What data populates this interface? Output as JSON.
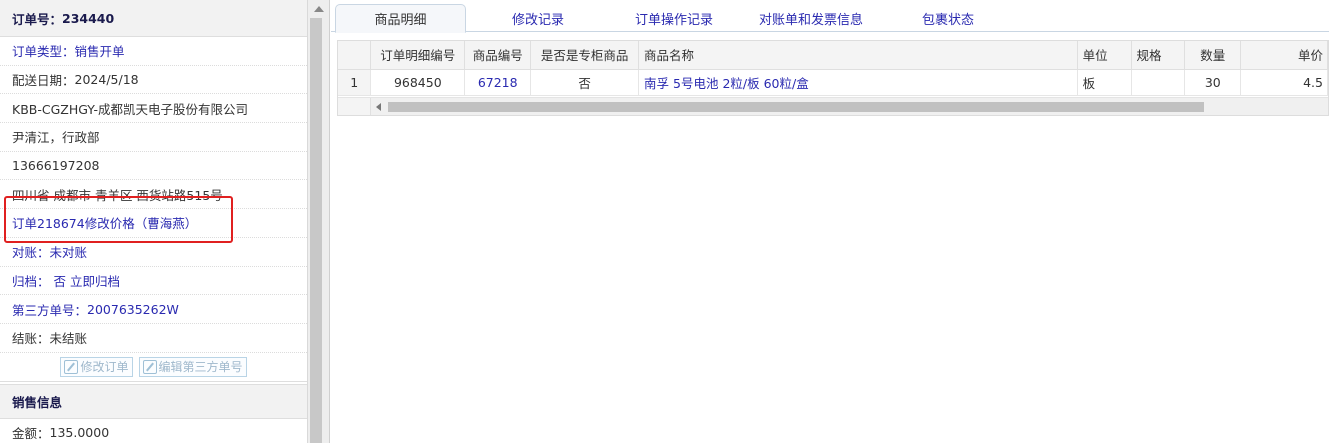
{
  "left": {
    "order_no_label": "订单号：",
    "order_no": "234440",
    "rows": [
      {
        "label": "订单类型：",
        "value": "销售开单"
      },
      {
        "label": "配送日期：",
        "value": "2024/5/18"
      },
      {
        "text": "KBB-CGZHGY-成都凯天电子股份有限公司"
      },
      {
        "text": "尹清江，行政部"
      },
      {
        "text": "13666197208"
      },
      {
        "text": "四川省 成都市 青羊区 西货站路515号"
      },
      {
        "text": "订单218674修改价格（曹海燕）"
      },
      {
        "label": "对账：",
        "value": "未对账"
      },
      {
        "label": "归档：",
        "value": "否",
        "link": "立即归档"
      },
      {
        "label": "第三方单号：",
        "value": "2007635262W"
      },
      {
        "label": "结账：",
        "value": "未结账"
      }
    ],
    "buttons": {
      "edit_order": "修改订单",
      "edit_third": "编辑第三方单号"
    },
    "sales_header": "销售信息",
    "amount_label": "金额：",
    "amount": "135.0000"
  },
  "tabs": [
    "商品明细",
    "修改记录",
    "订单操作记录",
    "对账单和发票信息",
    "包裹状态"
  ],
  "grid": {
    "columns": [
      "订单明细编号",
      "商品编号",
      "是否是专柜商品",
      "商品名称",
      "单位",
      "规格",
      "数量",
      "单价"
    ],
    "rows": [
      {
        "index": "1",
        "detail_no": "968450",
        "product_no": "67218",
        "is_counter": "否",
        "name": "南孚 5号电池 2粒/板 60粒/盒",
        "unit": "板",
        "spec": "",
        "qty": "30",
        "price": "4.5"
      }
    ]
  }
}
